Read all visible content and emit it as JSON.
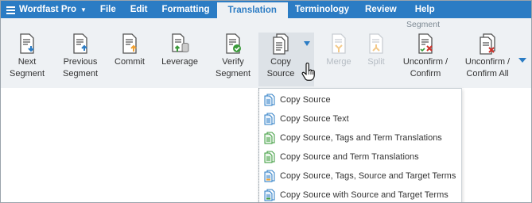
{
  "menubar": {
    "app_label": "Wordfast Pro",
    "items": [
      {
        "label": "File"
      },
      {
        "label": "Edit"
      },
      {
        "label": "Formatting"
      },
      {
        "label": "Translation"
      },
      {
        "label": "Terminology"
      },
      {
        "label": "Review"
      },
      {
        "label": "Help"
      }
    ],
    "active": "Translation"
  },
  "ribbon": {
    "group_label": "Segment",
    "buttons": [
      {
        "line1": "Next",
        "line2": "Segment",
        "icon": "next-segment-icon"
      },
      {
        "line1": "Previous",
        "line2": "Segment",
        "icon": "previous-segment-icon"
      },
      {
        "line1": "Commit",
        "line2": "",
        "icon": "commit-icon"
      },
      {
        "line1": "Leverage",
        "line2": "",
        "icon": "leverage-icon"
      },
      {
        "line1": "Verify",
        "line2": "Segment",
        "icon": "verify-segment-icon"
      },
      {
        "line1": "Copy",
        "line2": "Source",
        "icon": "copy-source-icon"
      },
      {
        "line1": "Merge",
        "line2": "",
        "icon": "merge-icon",
        "disabled": true
      },
      {
        "line1": "Split",
        "line2": "",
        "icon": "split-icon",
        "disabled": true
      },
      {
        "line1": "Unconfirm /",
        "line2": "Confirm",
        "icon": "unconfirm-confirm-icon"
      },
      {
        "line1": "Unconfirm /",
        "line2": "Confirm All",
        "icon": "unconfirm-confirm-all-icon"
      }
    ]
  },
  "dropdown": {
    "items": [
      {
        "label": "Copy Source"
      },
      {
        "label": "Copy Source Text"
      },
      {
        "label": "Copy Source, Tags and Term Translations"
      },
      {
        "label": "Copy Source and Term Translations"
      },
      {
        "label": "Copy Source, Tags, Source and Target Terms"
      },
      {
        "label": "Copy Source with Source and Target Terms"
      }
    ]
  },
  "colors": {
    "menubar_bg": "#2b7cc4",
    "ribbon_bg": "#eef1f4",
    "accent_orange": "#f0a030",
    "accent_green": "#3a9a3a",
    "accent_red": "#d0302a",
    "accent_blue": "#2b7cc4"
  }
}
